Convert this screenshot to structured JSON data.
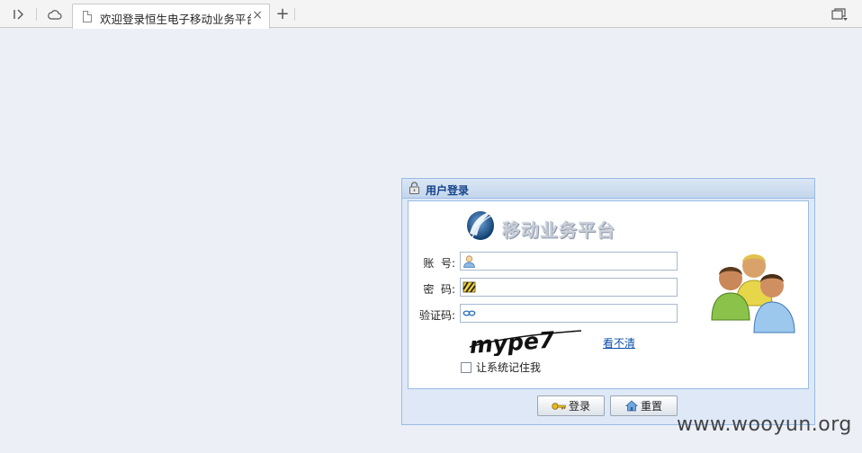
{
  "browser": {
    "tab_title": "欢迎登录恒生电子移动业务平台",
    "close_glyph": "×",
    "new_tab_glyph": "+"
  },
  "login": {
    "panel_title": "用户登录",
    "logo_text": "移动业务平台",
    "fields": [
      {
        "label": "账  号:",
        "value": ""
      },
      {
        "label": "密  码:",
        "value": ""
      },
      {
        "label": "验证码:",
        "value": ""
      }
    ],
    "captcha_text": "mype7",
    "refresh_link": "看不清",
    "remember_label": "让系统记住我",
    "remember_checked": false,
    "login_button": "登录",
    "reset_button": "重置"
  },
  "watermark": "www.wooyun.org",
  "colors": {
    "page_background": "#ecf0f6",
    "panel_background": "#dfe8f6",
    "panel_border": "#99bbe8",
    "title_color": "#15428b",
    "link_color": "#0b4fa8"
  }
}
